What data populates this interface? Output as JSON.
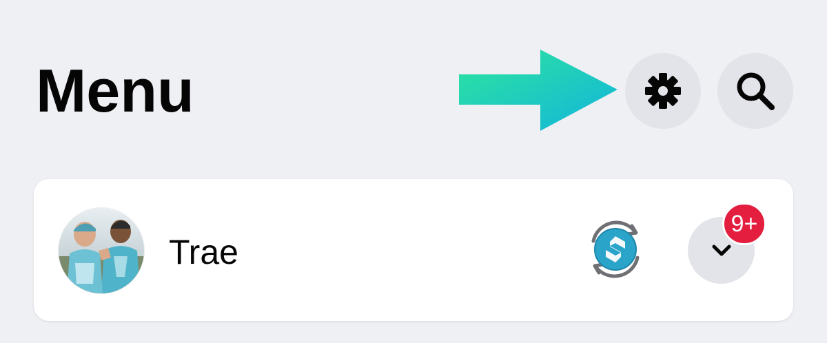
{
  "header": {
    "title": "Menu",
    "settings_icon": "gear-icon",
    "search_icon": "search-icon",
    "annotation": {
      "icon": "arrow-right-icon",
      "colors": [
        "#2ee59d",
        "#14b8d8"
      ]
    }
  },
  "profile": {
    "name": "Trae",
    "avatar": "profile-photo",
    "sync_icon": "sync-app-icon",
    "switch_icon": "chevron-down-icon",
    "notification_count": "9+"
  },
  "colors": {
    "background": "#eff0f4",
    "card": "#ffffff",
    "icon_button": "#e3e4e9",
    "badge": "#e41e3f",
    "text": "#050505"
  }
}
